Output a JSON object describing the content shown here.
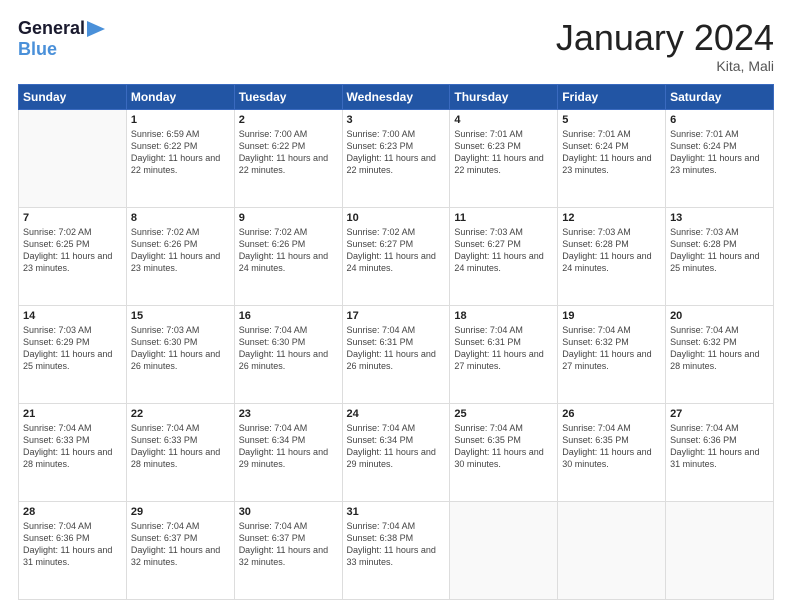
{
  "header": {
    "logo_line1": "General",
    "logo_line2": "Blue",
    "title": "January 2024",
    "location": "Kita, Mali"
  },
  "days_of_week": [
    "Sunday",
    "Monday",
    "Tuesday",
    "Wednesday",
    "Thursday",
    "Friday",
    "Saturday"
  ],
  "weeks": [
    [
      {
        "num": "",
        "empty": true
      },
      {
        "num": "1",
        "sunrise": "Sunrise: 6:59 AM",
        "sunset": "Sunset: 6:22 PM",
        "daylight": "Daylight: 11 hours and 22 minutes."
      },
      {
        "num": "2",
        "sunrise": "Sunrise: 7:00 AM",
        "sunset": "Sunset: 6:22 PM",
        "daylight": "Daylight: 11 hours and 22 minutes."
      },
      {
        "num": "3",
        "sunrise": "Sunrise: 7:00 AM",
        "sunset": "Sunset: 6:23 PM",
        "daylight": "Daylight: 11 hours and 22 minutes."
      },
      {
        "num": "4",
        "sunrise": "Sunrise: 7:01 AM",
        "sunset": "Sunset: 6:23 PM",
        "daylight": "Daylight: 11 hours and 22 minutes."
      },
      {
        "num": "5",
        "sunrise": "Sunrise: 7:01 AM",
        "sunset": "Sunset: 6:24 PM",
        "daylight": "Daylight: 11 hours and 23 minutes."
      },
      {
        "num": "6",
        "sunrise": "Sunrise: 7:01 AM",
        "sunset": "Sunset: 6:24 PM",
        "daylight": "Daylight: 11 hours and 23 minutes."
      }
    ],
    [
      {
        "num": "7",
        "sunrise": "Sunrise: 7:02 AM",
        "sunset": "Sunset: 6:25 PM",
        "daylight": "Daylight: 11 hours and 23 minutes."
      },
      {
        "num": "8",
        "sunrise": "Sunrise: 7:02 AM",
        "sunset": "Sunset: 6:26 PM",
        "daylight": "Daylight: 11 hours and 23 minutes."
      },
      {
        "num": "9",
        "sunrise": "Sunrise: 7:02 AM",
        "sunset": "Sunset: 6:26 PM",
        "daylight": "Daylight: 11 hours and 24 minutes."
      },
      {
        "num": "10",
        "sunrise": "Sunrise: 7:02 AM",
        "sunset": "Sunset: 6:27 PM",
        "daylight": "Daylight: 11 hours and 24 minutes."
      },
      {
        "num": "11",
        "sunrise": "Sunrise: 7:03 AM",
        "sunset": "Sunset: 6:27 PM",
        "daylight": "Daylight: 11 hours and 24 minutes."
      },
      {
        "num": "12",
        "sunrise": "Sunrise: 7:03 AM",
        "sunset": "Sunset: 6:28 PM",
        "daylight": "Daylight: 11 hours and 24 minutes."
      },
      {
        "num": "13",
        "sunrise": "Sunrise: 7:03 AM",
        "sunset": "Sunset: 6:28 PM",
        "daylight": "Daylight: 11 hours and 25 minutes."
      }
    ],
    [
      {
        "num": "14",
        "sunrise": "Sunrise: 7:03 AM",
        "sunset": "Sunset: 6:29 PM",
        "daylight": "Daylight: 11 hours and 25 minutes."
      },
      {
        "num": "15",
        "sunrise": "Sunrise: 7:03 AM",
        "sunset": "Sunset: 6:30 PM",
        "daylight": "Daylight: 11 hours and 26 minutes."
      },
      {
        "num": "16",
        "sunrise": "Sunrise: 7:04 AM",
        "sunset": "Sunset: 6:30 PM",
        "daylight": "Daylight: 11 hours and 26 minutes."
      },
      {
        "num": "17",
        "sunrise": "Sunrise: 7:04 AM",
        "sunset": "Sunset: 6:31 PM",
        "daylight": "Daylight: 11 hours and 26 minutes."
      },
      {
        "num": "18",
        "sunrise": "Sunrise: 7:04 AM",
        "sunset": "Sunset: 6:31 PM",
        "daylight": "Daylight: 11 hours and 27 minutes."
      },
      {
        "num": "19",
        "sunrise": "Sunrise: 7:04 AM",
        "sunset": "Sunset: 6:32 PM",
        "daylight": "Daylight: 11 hours and 27 minutes."
      },
      {
        "num": "20",
        "sunrise": "Sunrise: 7:04 AM",
        "sunset": "Sunset: 6:32 PM",
        "daylight": "Daylight: 11 hours and 28 minutes."
      }
    ],
    [
      {
        "num": "21",
        "sunrise": "Sunrise: 7:04 AM",
        "sunset": "Sunset: 6:33 PM",
        "daylight": "Daylight: 11 hours and 28 minutes."
      },
      {
        "num": "22",
        "sunrise": "Sunrise: 7:04 AM",
        "sunset": "Sunset: 6:33 PM",
        "daylight": "Daylight: 11 hours and 28 minutes."
      },
      {
        "num": "23",
        "sunrise": "Sunrise: 7:04 AM",
        "sunset": "Sunset: 6:34 PM",
        "daylight": "Daylight: 11 hours and 29 minutes."
      },
      {
        "num": "24",
        "sunrise": "Sunrise: 7:04 AM",
        "sunset": "Sunset: 6:34 PM",
        "daylight": "Daylight: 11 hours and 29 minutes."
      },
      {
        "num": "25",
        "sunrise": "Sunrise: 7:04 AM",
        "sunset": "Sunset: 6:35 PM",
        "daylight": "Daylight: 11 hours and 30 minutes."
      },
      {
        "num": "26",
        "sunrise": "Sunrise: 7:04 AM",
        "sunset": "Sunset: 6:35 PM",
        "daylight": "Daylight: 11 hours and 30 minutes."
      },
      {
        "num": "27",
        "sunrise": "Sunrise: 7:04 AM",
        "sunset": "Sunset: 6:36 PM",
        "daylight": "Daylight: 11 hours and 31 minutes."
      }
    ],
    [
      {
        "num": "28",
        "sunrise": "Sunrise: 7:04 AM",
        "sunset": "Sunset: 6:36 PM",
        "daylight": "Daylight: 11 hours and 31 minutes."
      },
      {
        "num": "29",
        "sunrise": "Sunrise: 7:04 AM",
        "sunset": "Sunset: 6:37 PM",
        "daylight": "Daylight: 11 hours and 32 minutes."
      },
      {
        "num": "30",
        "sunrise": "Sunrise: 7:04 AM",
        "sunset": "Sunset: 6:37 PM",
        "daylight": "Daylight: 11 hours and 32 minutes."
      },
      {
        "num": "31",
        "sunrise": "Sunrise: 7:04 AM",
        "sunset": "Sunset: 6:38 PM",
        "daylight": "Daylight: 11 hours and 33 minutes."
      },
      {
        "num": "",
        "empty": true
      },
      {
        "num": "",
        "empty": true
      },
      {
        "num": "",
        "empty": true
      }
    ]
  ]
}
